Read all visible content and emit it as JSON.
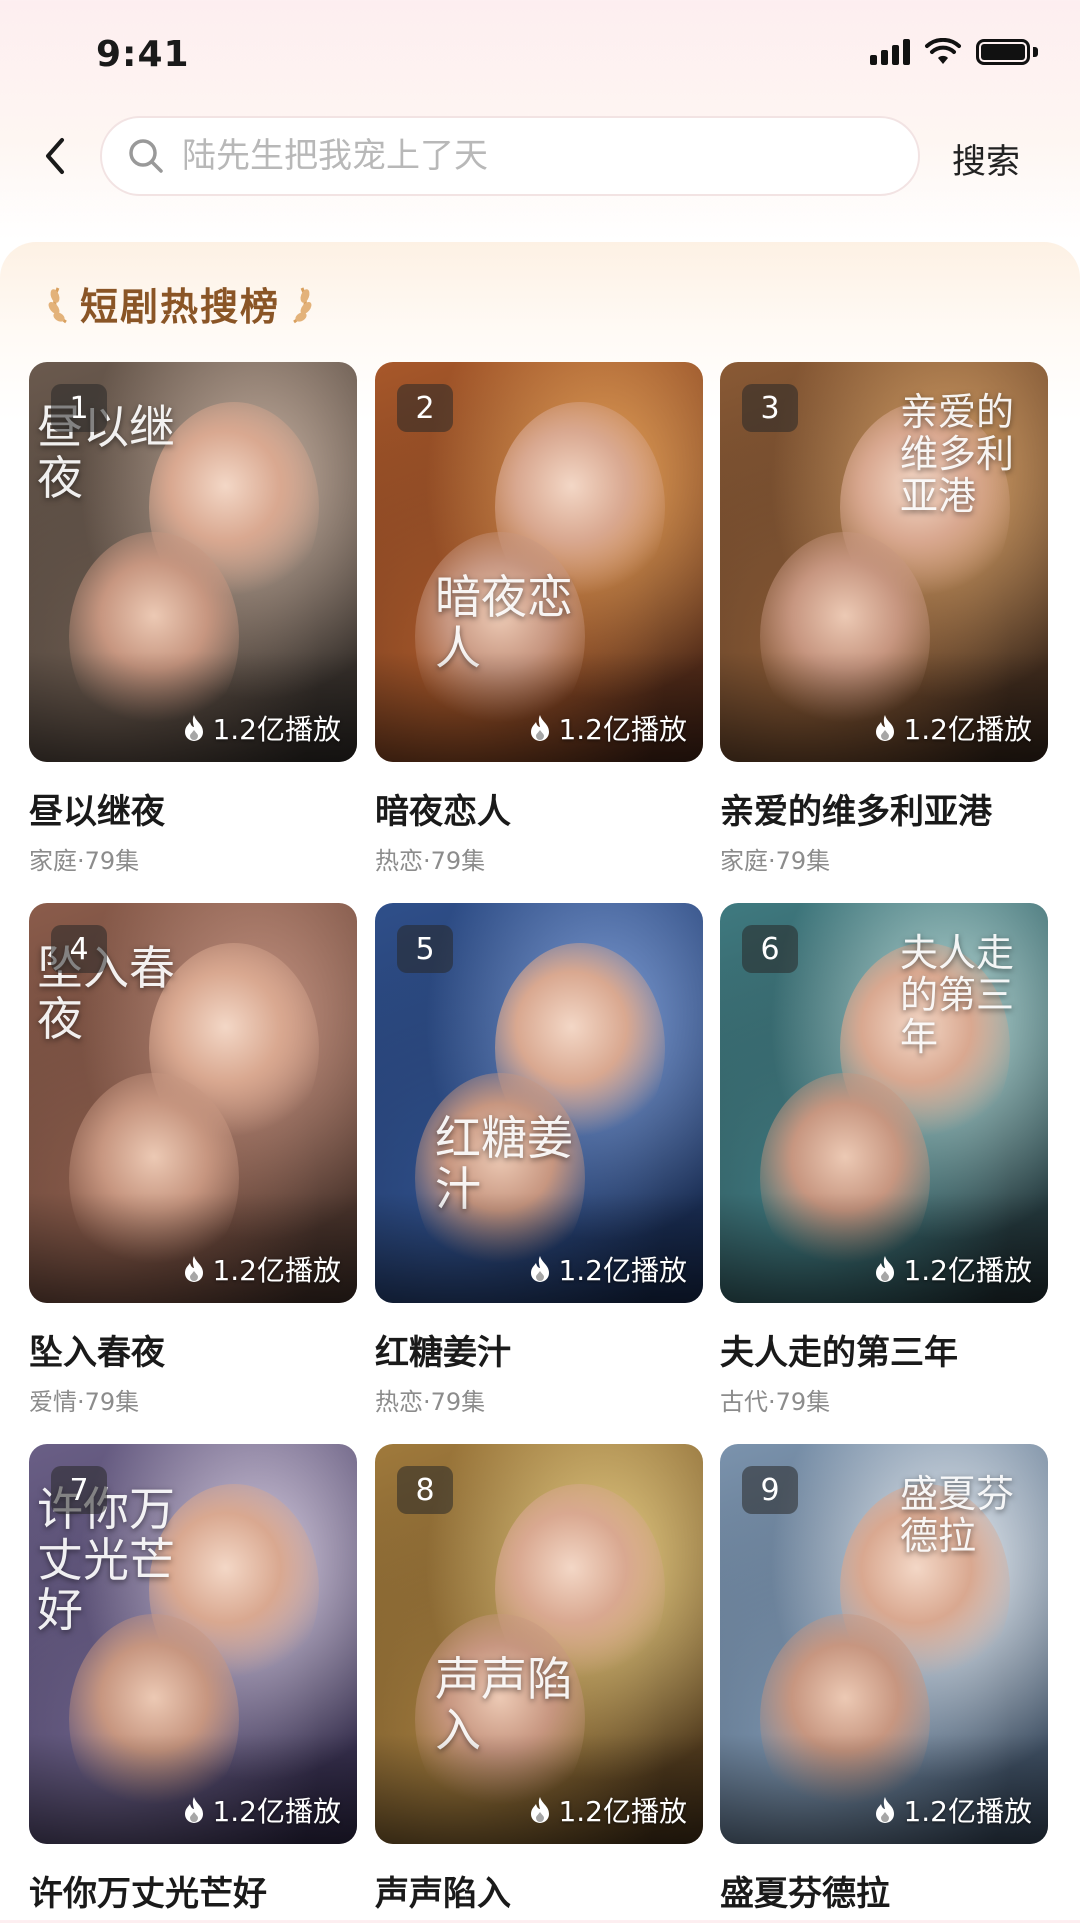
{
  "status": {
    "time": "9:41"
  },
  "header": {
    "search_placeholder": "陆先生把我宠上了天",
    "search_button": "搜索"
  },
  "section": {
    "title": "短剧热搜榜"
  },
  "cards": [
    {
      "rank": "1",
      "title": "昼以继夜",
      "meta": "家庭·79集",
      "plays": "1.2亿播放",
      "poster_text": "昼以继夜",
      "colors": [
        "#2a2623",
        "#6b5a4e",
        "#c9b3a3"
      ]
    },
    {
      "rank": "2",
      "title": "暗夜恋人",
      "meta": "热恋·79集",
      "plays": "1.2亿播放",
      "poster_text": "暗夜恋人",
      "colors": [
        "#3b1f14",
        "#a8582a",
        "#e7a35a"
      ]
    },
    {
      "rank": "3",
      "title": "亲爱的维多利亚港",
      "meta": "家庭·79集",
      "plays": "1.2亿播放",
      "poster_text": "亲爱的维多利亚港",
      "colors": [
        "#2f2118",
        "#8a5a35",
        "#d9a46a"
      ]
    },
    {
      "rank": "4",
      "title": "坠入春夜",
      "meta": "爱情·79集",
      "plays": "1.2亿播放",
      "poster_text": "坠入春夜",
      "colors": [
        "#3a2a24",
        "#8b5c4b",
        "#c89684"
      ]
    },
    {
      "rank": "5",
      "title": "红糖姜汁",
      "meta": "热恋·79集",
      "plays": "1.2亿播放",
      "poster_text": "红糖姜汁",
      "colors": [
        "#142444",
        "#2f4f8a",
        "#7f9ed6"
      ]
    },
    {
      "rank": "6",
      "title": "夫人走的第三年",
      "meta": "古代·79集",
      "plays": "1.2亿播放",
      "poster_text": "夫人走的第三年",
      "colors": [
        "#1e2a2e",
        "#3f7a80",
        "#b7d9d6"
      ]
    },
    {
      "rank": "7",
      "title": "许你万丈光芒好",
      "meta": "",
      "plays": "1.2亿播放",
      "poster_text": "许你万丈光芒好",
      "colors": [
        "#2a2440",
        "#6a5f86",
        "#d7cde0"
      ]
    },
    {
      "rank": "8",
      "title": "声声陷入",
      "meta": "",
      "plays": "1.2亿播放",
      "poster_text": "声声陷入",
      "colors": [
        "#3d2b16",
        "#a07a3c",
        "#e9cf86"
      ]
    },
    {
      "rank": "9",
      "title": "盛夏芬德拉",
      "meta": "",
      "plays": "1.2亿播放",
      "poster_text": "盛夏芬德拉",
      "colors": [
        "#314052",
        "#7b93ad",
        "#e9eef3"
      ]
    }
  ]
}
